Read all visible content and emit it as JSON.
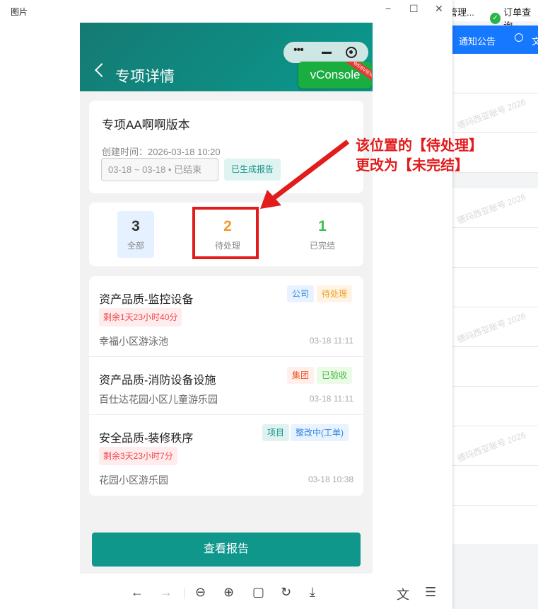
{
  "viewer": {
    "title": "图片",
    "controls": {
      "min": "−",
      "max": "☐",
      "close": "✕"
    }
  },
  "background_app": {
    "topbar": {
      "item1": "管理...",
      "item2": "订单查询"
    },
    "bluebar": {
      "notice": "通知公告",
      "w": "文"
    },
    "watermark": "德玛西亚账号 2026"
  },
  "phone": {
    "header": {
      "title": "专项详情"
    },
    "vconsole": {
      "label": "vConsole",
      "ribbon": "WEBVIEW"
    },
    "info": {
      "title": "专项AA啊啊版本",
      "created": "创建时间：2026-03-18 10:20",
      "range": "03-18 ~ 03-18 • 已结束",
      "status": "已生成报告"
    },
    "stats": {
      "all": {
        "num": "3",
        "label": "全部"
      },
      "pending": {
        "num": "2",
        "label": "待处理"
      },
      "done": {
        "num": "1",
        "label": "已完结"
      }
    },
    "items": [
      {
        "title": "资产品质-监控设备",
        "tags": [
          "公司",
          "待处理"
        ],
        "remain": "剩余1天23小时40分",
        "location": "幸福小区游泳池",
        "time": "03-18 11:11"
      },
      {
        "title": "资产品质-消防设备设施",
        "tags": [
          "集团",
          "已验收"
        ],
        "remain": "",
        "location": "百仕达花园小区儿童游乐园",
        "time": "03-18 11:11"
      },
      {
        "title": "安全品质-装修秩序",
        "tags": [
          "项目",
          "整改中(工单)"
        ],
        "remain": "剩余3天23小时7分",
        "location": "花园小区游乐园",
        "time": "03-18 10:38"
      }
    ],
    "report_button": "查看报告"
  },
  "annotation": {
    "line1": "该位置的【待处理】",
    "line2": "更改为【未完结】",
    "color": "#e21b1b"
  }
}
